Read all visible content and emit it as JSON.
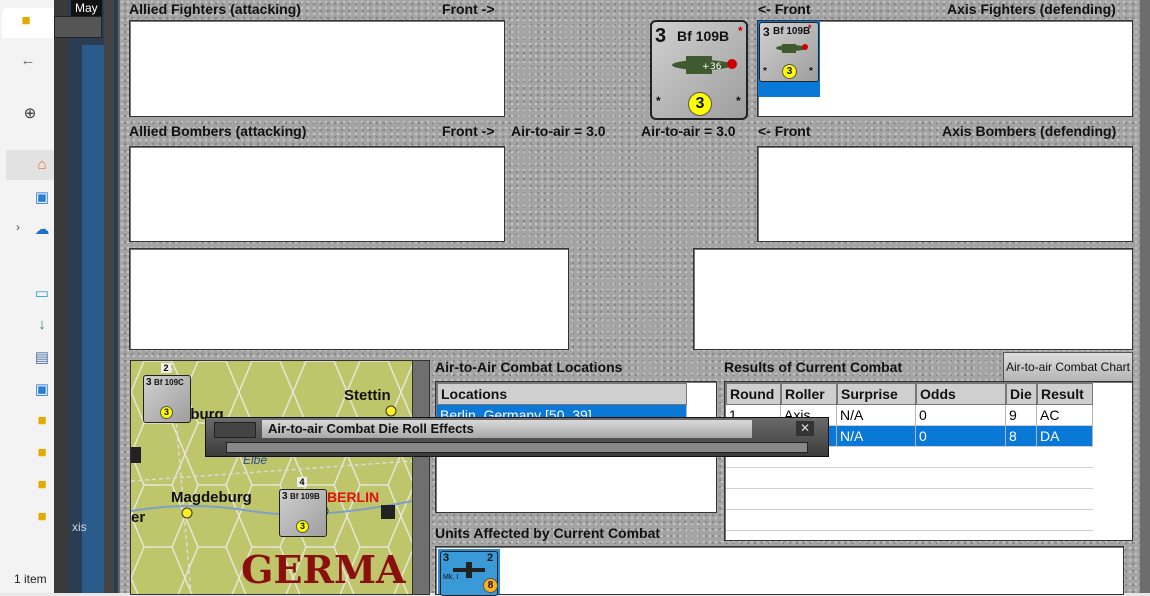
{
  "explorer": {
    "status": "1 item",
    "icons": [
      "folder-icon",
      "back-arrow-icon",
      "new-icon",
      "home-icon",
      "gallery-icon",
      "onedrive-icon",
      "desktop-icon",
      "downloads-icon",
      "documents-icon",
      "pictures-icon",
      "folder-icon",
      "folder-icon",
      "folder-icon",
      "folder-icon"
    ]
  },
  "window": {
    "tab_fragment": "May",
    "side_fragment_1": "xis",
    "side_fragment_2": "er"
  },
  "panels": {
    "allied_fighters": "Allied Fighters (attacking)",
    "front_right": "Front ->",
    "front_left": "<- Front",
    "axis_fighters": "Axis Fighters (defending)",
    "allied_bombers": "Allied Bombers (attacking)",
    "air_to_air_left": "Air-to-air = 3.0",
    "air_to_air_right": "Air-to-air = 3.0",
    "axis_bombers": "Axis Bombers (defending)"
  },
  "counter_large": {
    "strength": "3",
    "name": "Bf 109B",
    "circle": "3",
    "star": "*",
    "plane_marking": "36"
  },
  "counter_small": {
    "strength": "3",
    "name": "Bf 109B",
    "circle": "3",
    "star": "*"
  },
  "map": {
    "labels": {
      "stettin": "Stettin",
      "hamburg": "mburg",
      "magdeburg": "Magdeburg",
      "berlin": "BERLIN",
      "germany": "GERMA",
      "elbe": "Elbe",
      "fragment": "er"
    },
    "unit_a": {
      "strength": "3",
      "name": "Bf 109C",
      "circle": "3",
      "stack": "2"
    },
    "unit_b": {
      "strength": "3",
      "name": "Bf 109B",
      "circle": "3",
      "stack": "4"
    }
  },
  "locations": {
    "title": "Air-to-Air Combat Locations",
    "header": "Locations",
    "rows": [
      "Berlin, Germany [50, 39]"
    ]
  },
  "results": {
    "title": "Results of Current Combat",
    "chart_button": "Air-to-air Combat Chart",
    "columns": [
      "Round",
      "Roller",
      "Surprise",
      "Odds",
      "Die",
      "Result"
    ],
    "rows": [
      [
        "1",
        "Axis",
        "N/A",
        "0",
        "9",
        "AC"
      ],
      [
        "",
        "",
        "N/A",
        "0",
        "8",
        "DA"
      ]
    ]
  },
  "dialog": {
    "title": "Air-to-air Combat Die Roll Effects",
    "close": "✕"
  },
  "units_affected": {
    "title": "Units Affected by Current Combat",
    "unit": {
      "strength": "3",
      "stack": "2",
      "circle": "8",
      "label": "Mk. I"
    }
  },
  "colors": {
    "selection": "#0a78d7",
    "panel": "#a4a4a4",
    "circle": "#ffff00",
    "berlin": "#e01010",
    "germany": "#8a1010"
  }
}
